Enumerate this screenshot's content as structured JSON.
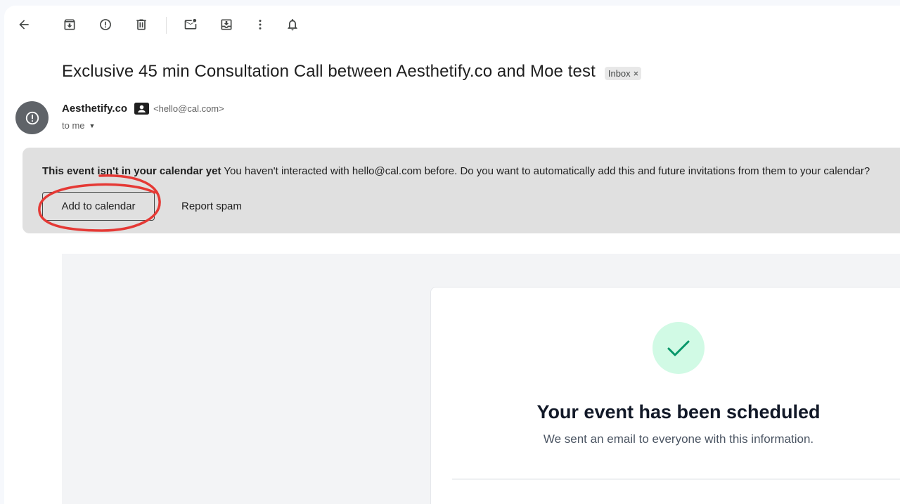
{
  "toolbar": {
    "icons": [
      "back-arrow-icon",
      "archive-icon",
      "report-spam-icon",
      "delete-icon",
      "mark-unread-icon",
      "move-to-icon",
      "more-vert-icon",
      "snooze-bell-icon"
    ]
  },
  "message": {
    "subject": "Exclusive 45 min Consultation Call between Aesthetify.co and Moe test",
    "label": "Inbox",
    "label_remove": "×",
    "sender_name": "Aesthetify.co",
    "sender_email": "<hello@cal.com>",
    "recipient": "to me"
  },
  "banner": {
    "strong_text": "This event isn't in your calendar yet",
    "text": "You haven't interacted with hello@cal.com before. Do you want to automatically add this and future invitations from them to your calendar?",
    "add_button": "Add to calendar",
    "spam_button": "Report spam"
  },
  "email": {
    "title": "Your event has been scheduled",
    "subtitle": "We sent an email to everyone with this information."
  },
  "colors": {
    "banner_bg": "#e0e0e0",
    "success_circle": "#d1fae5",
    "success_check": "#059669",
    "annotation": "#e53935"
  }
}
